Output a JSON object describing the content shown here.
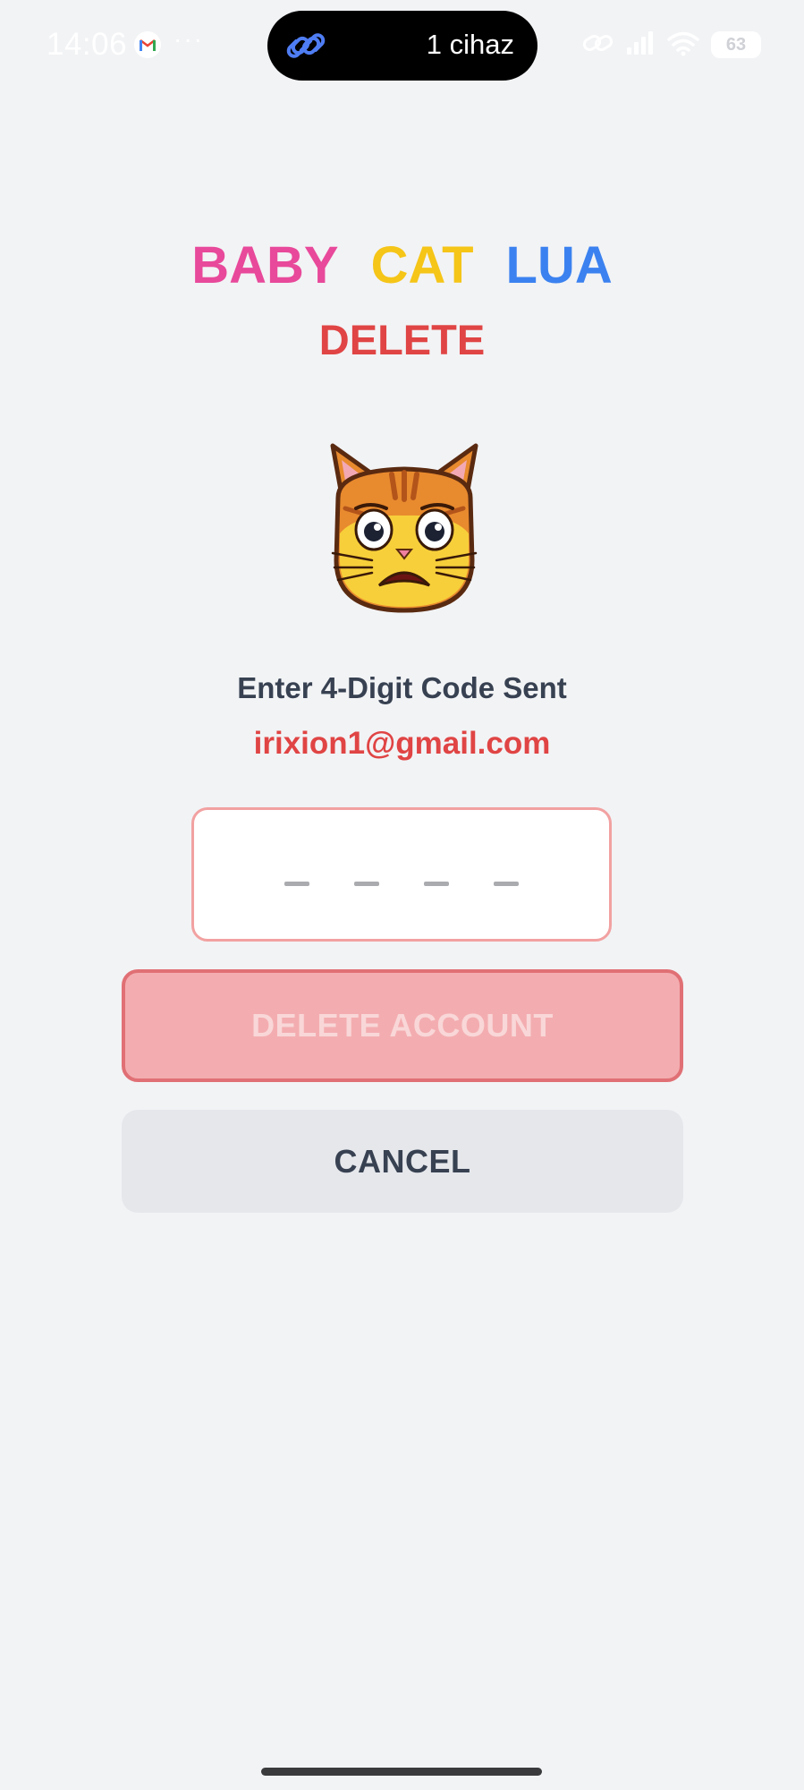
{
  "status_bar": {
    "time": "14:06",
    "more": "···",
    "island_label": "1 cihaz",
    "battery": "63"
  },
  "title": {
    "word1": "BABY",
    "word2": "CAT",
    "word3": "LUA",
    "subtitle": "DELETE"
  },
  "prompt": {
    "text": "Enter 4-Digit Code Sent",
    "email": "irixion1@gmail.com"
  },
  "code_input": {
    "value": "",
    "slot_count": 4
  },
  "buttons": {
    "delete_label": "DELETE ACCOUNT",
    "cancel_label": "CANCEL"
  },
  "colors": {
    "baby": "#e8499a",
    "cat": "#f5c518",
    "lua": "#3b82f0",
    "danger": "#e04444",
    "delete_disabled_bg": "#f3adb0",
    "cancel_bg": "#e5e7eb"
  },
  "icons": {
    "gmail": "gmail-icon",
    "link": "link-icon",
    "wifi": "wifi-icon",
    "signal": "signal-icon",
    "cat": "scared-cat-icon"
  }
}
